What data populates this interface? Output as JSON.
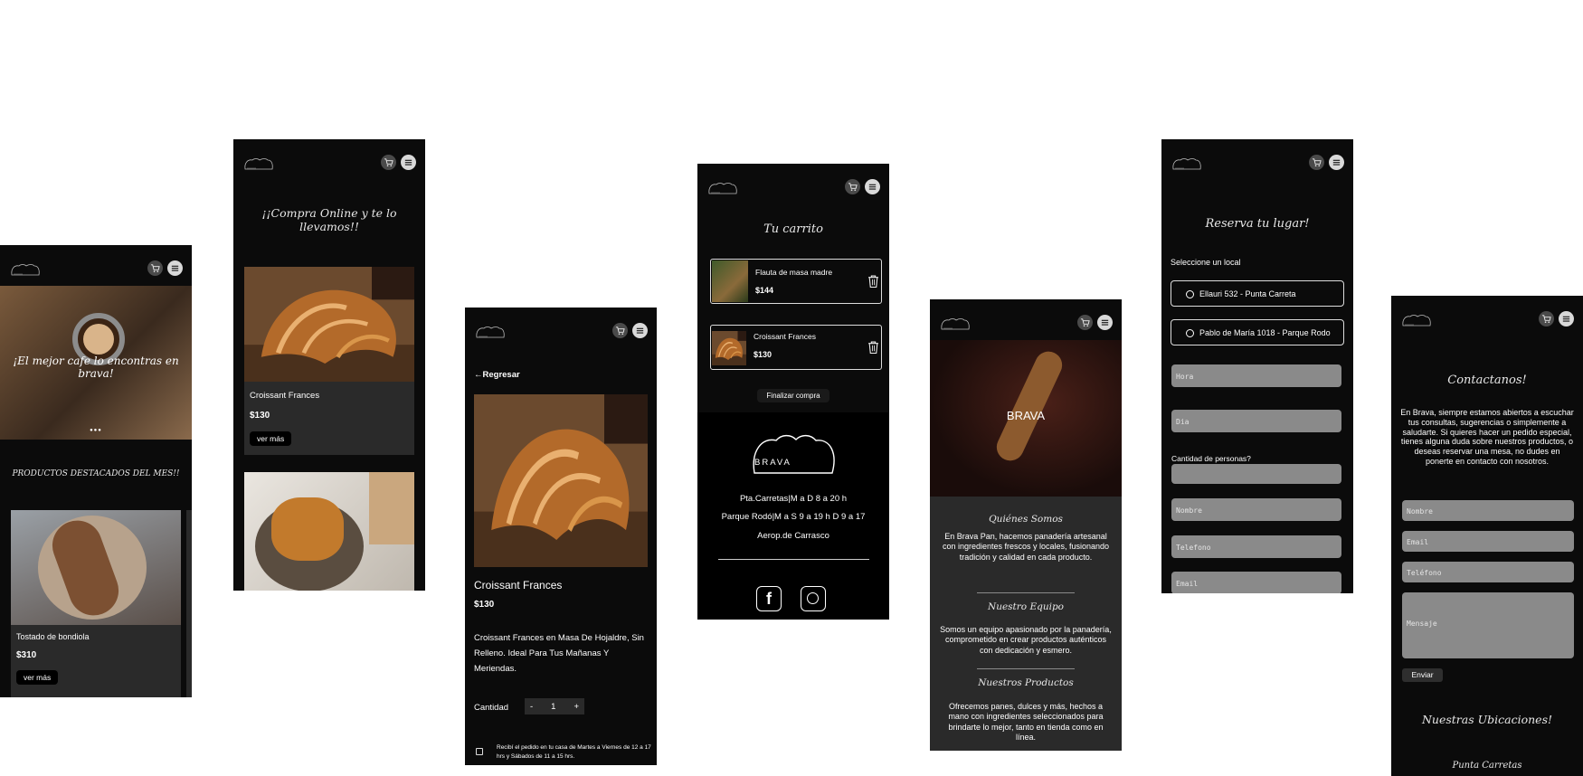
{
  "colors": {
    "bg": "#0b0b0b",
    "card": "#2a2a2a",
    "field": "#8a8a8a",
    "accent": "#ffffff"
  },
  "icons": {
    "cart": "cart-icon",
    "menu": "menu-icon",
    "logo": "bread-logo",
    "trash": "trash-icon",
    "facebook": "facebook-icon",
    "instagram": "instagram-icon",
    "back": "arrow-left-icon",
    "bag": "bag-icon",
    "radio": "radio-icon"
  },
  "home": {
    "hero_text": "¡El mejor cafe lo encontras en brava!",
    "carousel_dots": "●●●",
    "featured_title": "PRODUCTOS DESTACADOS DEL MES!!",
    "product": {
      "name": "Tostado de bondiola",
      "price": "$310",
      "button": "ver más"
    }
  },
  "shop": {
    "title": "¡¡Compra Online y te lo llevamos!!",
    "product": {
      "name": "Croissant Frances",
      "price": "$130",
      "button": "ver más"
    }
  },
  "detail": {
    "back": "Regresar",
    "name": "Croissant Frances",
    "price": "$130",
    "description": "Croissant Frances en Masa De Hojaldre, Sin Relleno. Ideal Para Tus Mañanas Y Meriendas.",
    "qty_label": "Cantidad",
    "qty_minus": "-",
    "qty_value": "1",
    "qty_plus": "+",
    "delivery_note": "Recibí el pedido en tu casa de Martes a Viernes de 12 a 17 hrs y Sábados de 11 a 15 hrs."
  },
  "cart": {
    "title": "Tu carrito",
    "items": [
      {
        "name": "Flauta de masa madre",
        "price": "$144"
      },
      {
        "name": "Croissant Frances",
        "price": "$130"
      }
    ],
    "checkout": "Finalizar compra",
    "brand": "BRAVA",
    "hours": [
      "Pta.Carretas|M a D 8 a 20 h",
      "Parque Rodó|M a S 9 a 19 h D 9 a 17",
      "Aerop.de Carrasco"
    ]
  },
  "about": {
    "hero_title": "BRAVA",
    "sections": [
      {
        "title": "Quiénes Somos",
        "text": "En Brava Pan, hacemos panadería artesanal con ingredientes frescos y locales, fusionando tradición y calidad en cada producto."
      },
      {
        "title": "Nuestro Equipo",
        "text": "Somos un equipo apasionado por la panadería, comprometido en crear productos auténticos con dedicación y esmero."
      },
      {
        "title": "Nuestros Productos",
        "text": "Ofrecemos panes, dulces y más, hechos a mano con ingredientes seleccionados para brindarte lo mejor, tanto en tienda como en línea."
      }
    ]
  },
  "reserve": {
    "title": "Reserva tu lugar!",
    "select_label": "Seleccione un local",
    "locations": [
      "Ellauri 532 - Punta Carreta",
      "Pablo de María 1018 - Parque Rodo"
    ],
    "hora_placeholder": "Hora",
    "dia_placeholder": "Dia",
    "people_label": "Cantidad de personas?",
    "nombre_placeholder": "Nombre",
    "telefono_placeholder": "Telefono",
    "email_placeholder": "Email"
  },
  "contact": {
    "title": "Contactanos!",
    "text": "En Brava, siempre estamos abiertos a escuchar tus consultas, sugerencias o simplemente a saludarte. Si quieres hacer un pedido especial, tienes alguna duda sobre nuestros productos, o deseas reservar una mesa, no dudes en ponerte en contacto con nosotros.",
    "nombre_placeholder": "Nombre",
    "email_placeholder": "Email",
    "telefono_placeholder": "Teléfono",
    "mensaje_placeholder": "Mensaje",
    "send": "Enviar",
    "locations_title": "Nuestras Ubicaciones!",
    "first_location": "Punta Carretas"
  }
}
